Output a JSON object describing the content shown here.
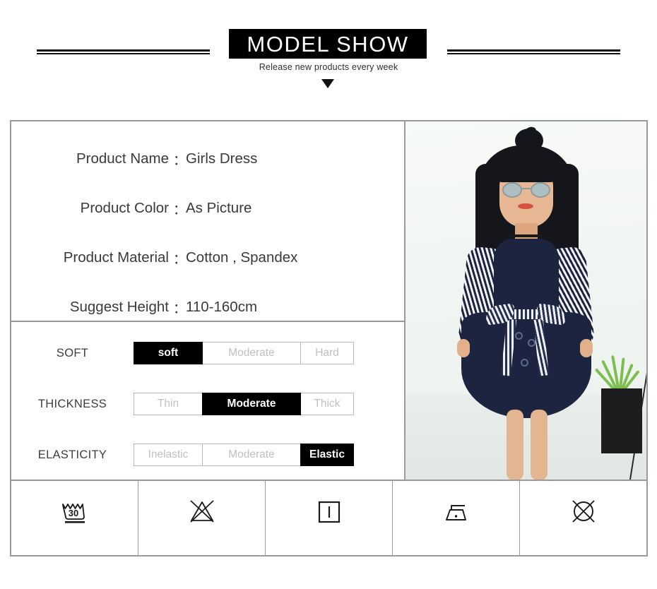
{
  "header": {
    "title": "MODEL SHOW",
    "subtitle": "Release new products every week",
    "arrow_icon": "triangle-down-icon",
    "rule_left_icon": "decorative-rule-left",
    "rule_right_icon": "decorative-rule-right"
  },
  "specs": [
    {
      "label": "Product Name",
      "colon": "：",
      "value": "Girls Dress"
    },
    {
      "label": "Product Color",
      "colon": "：",
      "value": "As Picture"
    },
    {
      "label": "Product Material",
      "colon": "：",
      "value": "Cotton , Spandex"
    },
    {
      "label": "Suggest Height",
      "colon": "：",
      "value": "110-160cm"
    }
  ],
  "attributes": [
    {
      "name": "SOFT",
      "options": [
        {
          "label": "soft",
          "selected": true
        },
        {
          "label": "Moderate",
          "selected": false
        },
        {
          "label": "Hard",
          "selected": false
        }
      ]
    },
    {
      "name": "THICKNESS",
      "options": [
        {
          "label": "Thin",
          "selected": false
        },
        {
          "label": "Moderate",
          "selected": true
        },
        {
          "label": "Thick",
          "selected": false
        }
      ]
    },
    {
      "name": "ELASTICITY",
      "options": [
        {
          "label": "Inelastic",
          "selected": false
        },
        {
          "label": "Moderate",
          "selected": false
        },
        {
          "label": "Elastic",
          "selected": true
        }
      ]
    }
  ],
  "care_symbols": [
    {
      "icon": "wash-30-icon",
      "temperature": "30"
    },
    {
      "icon": "do-not-bleach-icon"
    },
    {
      "icon": "drip-dry-icon"
    },
    {
      "icon": "iron-low-heat-icon"
    },
    {
      "icon": "do-not-dry-clean-icon"
    }
  ],
  "photo": {
    "icon": "model-photo",
    "description": "Girl wearing navy dress with striped sleeves and bow belt"
  },
  "colors": {
    "title_bg": "#000000",
    "title_text": "#ffffff",
    "border": "#9a9a9a",
    "text": "#3a3a3a",
    "muted_option": "#c0c0c0",
    "dress_navy": "#1d2440"
  }
}
